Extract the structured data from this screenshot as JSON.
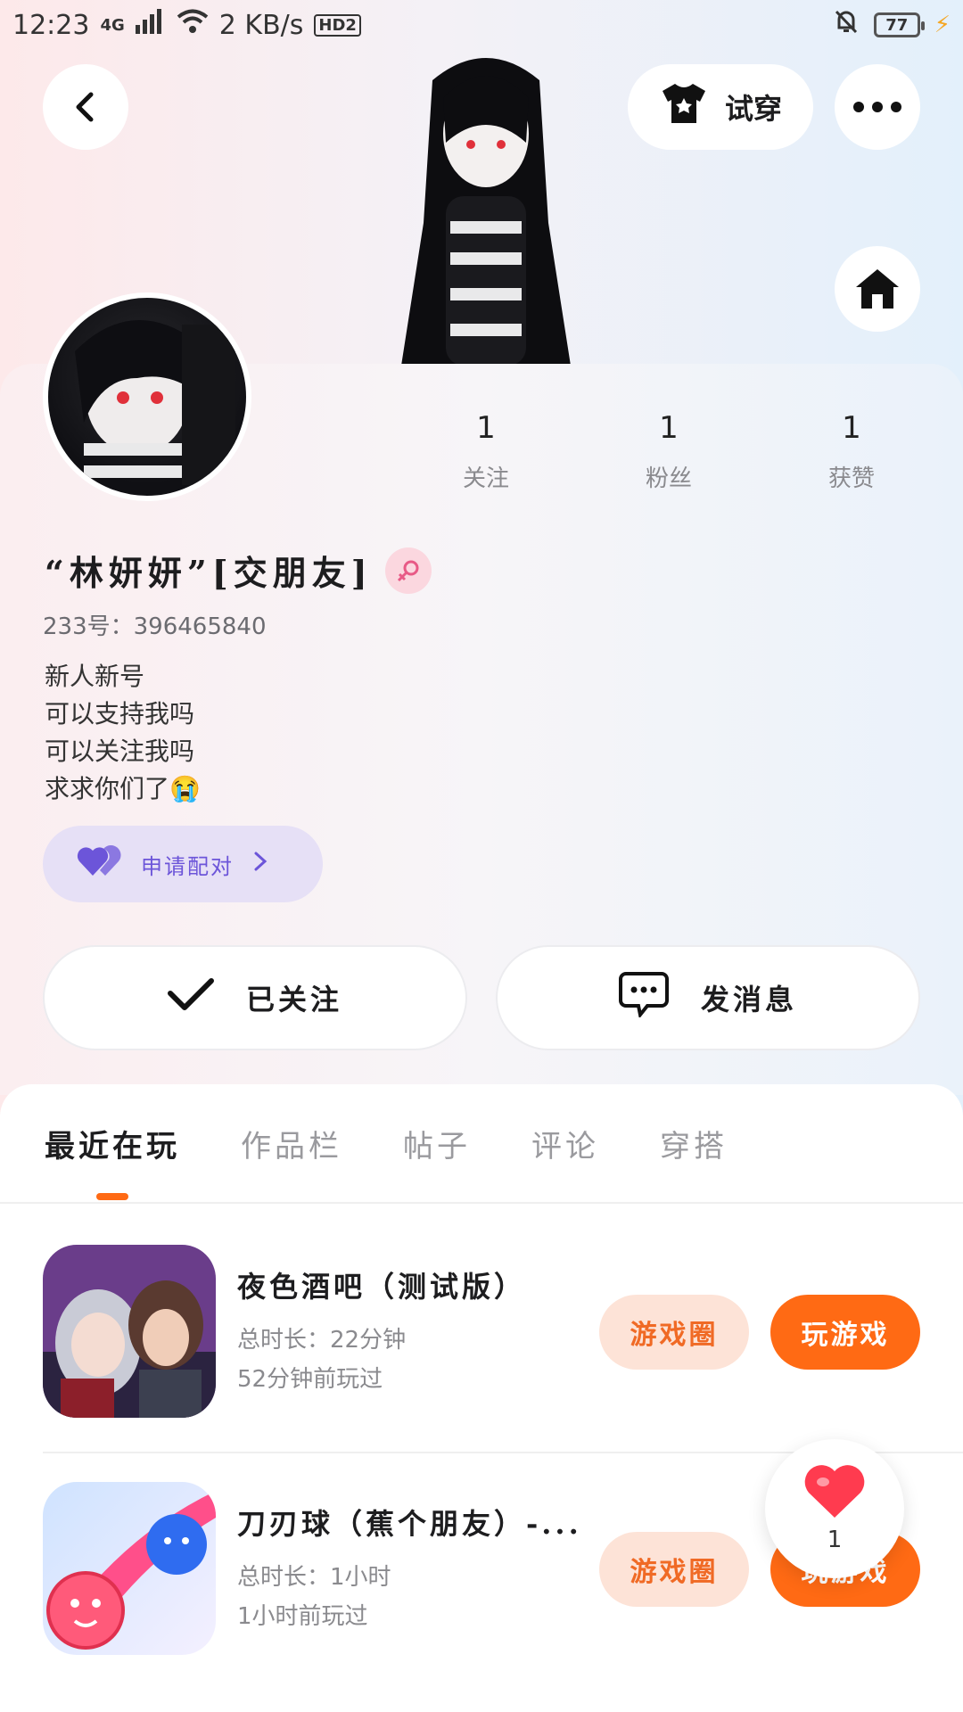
{
  "status_bar": {
    "time": "12:23",
    "network": "4G",
    "speed": "2 KB/s",
    "hd": "HD2",
    "battery": "77"
  },
  "header": {
    "tryon_label": "试穿"
  },
  "profile": {
    "stats": [
      {
        "value": "1",
        "label": "关注"
      },
      {
        "value": "1",
        "label": "粉丝"
      },
      {
        "value": "1",
        "label": "获赞"
      }
    ],
    "name": "“林妍妍”[交朋友]",
    "id_line": "233号：396465840",
    "bio": [
      "新人新号",
      "可以支持我吗",
      "可以关注我吗",
      "求求你们了😭"
    ],
    "pair_label": "申请配对",
    "follow_label": "已关注",
    "message_label": "发消息"
  },
  "tabs": [
    {
      "label": "最近在玩",
      "active": true
    },
    {
      "label": "作品栏"
    },
    {
      "label": "帖子"
    },
    {
      "label": "评论"
    },
    {
      "label": "穿搭"
    }
  ],
  "games": [
    {
      "title": "夜色酒吧（测试版）",
      "duration": "总时长：22分钟",
      "last_played": "52分钟前玩过",
      "circle_label": "游戏圈",
      "play_label": "玩游戏"
    },
    {
      "title": "刀刃球（蕉个朋友）-...",
      "duration": "总时长：1小时",
      "last_played": "1小时前玩过",
      "circle_label": "游戏圈",
      "play_label": "玩游戏"
    }
  ],
  "floating_like": {
    "count": "1"
  },
  "colors": {
    "accent": "#ff6a14",
    "pair": "#6c55d9",
    "gender": "#e85a86"
  }
}
